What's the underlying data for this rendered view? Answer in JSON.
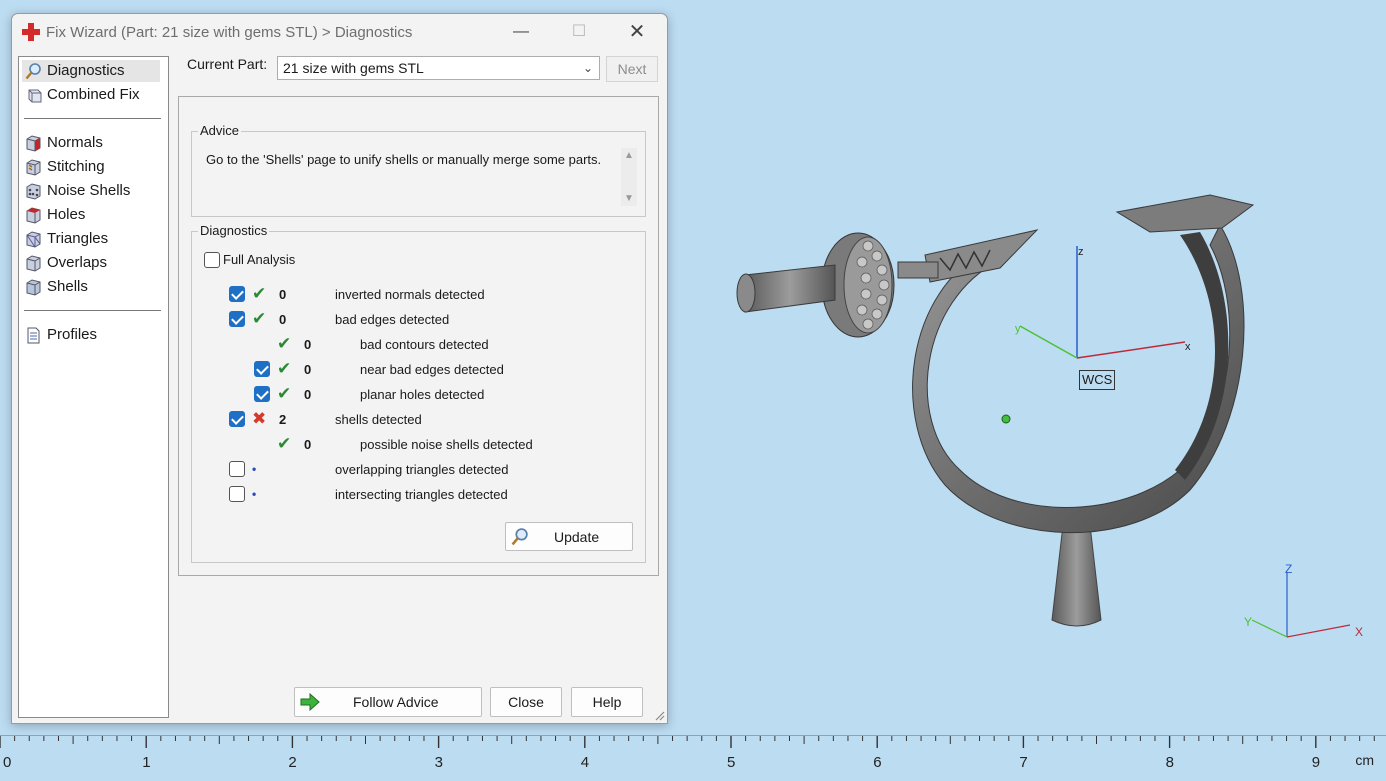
{
  "dialog": {
    "title": "Fix Wizard (Part: 21 size with gems STL) > Diagnostics",
    "window_controls": {
      "minimize": "—",
      "maximize": "☐",
      "close": "✕"
    }
  },
  "sidebar": {
    "items": [
      {
        "label": "Diagnostics",
        "icon": "magnifier-icon",
        "selected": true
      },
      {
        "label": "Combined Fix",
        "icon": "cube-icon"
      },
      {
        "label": "Normals",
        "icon": "normals-cube-icon"
      },
      {
        "label": "Stitching",
        "icon": "stitching-cube-icon"
      },
      {
        "label": "Noise Shells",
        "icon": "noise-shells-icon"
      },
      {
        "label": "Holes",
        "icon": "holes-cube-icon"
      },
      {
        "label": "Triangles",
        "icon": "triangles-cube-icon"
      },
      {
        "label": "Overlaps",
        "icon": "overlaps-cube-icon"
      },
      {
        "label": "Shells",
        "icon": "shells-cube-icon"
      },
      {
        "label": "Profiles",
        "icon": "document-icon"
      }
    ]
  },
  "current_part": {
    "label": "Current Part:",
    "value": "21 size with gems STL",
    "next_label": "Next"
  },
  "advice": {
    "title": "Advice",
    "text": "Go to the 'Shells' page to unify shells or manually merge some parts."
  },
  "diagnostics": {
    "title": "Diagnostics",
    "full_analysis_label": "Full Analysis",
    "full_analysis_checked": false,
    "rows": [
      {
        "checkbox": "checked",
        "status": "ok",
        "count": "0",
        "label": "inverted normals detected"
      },
      {
        "checkbox": "checked",
        "status": "ok",
        "count": "0",
        "label": "bad edges detected"
      },
      {
        "checkbox": "none",
        "status": "ok",
        "count": "0",
        "label": "bad contours detected"
      },
      {
        "checkbox": "checked",
        "status": "ok",
        "count": "0",
        "label": "near bad edges detected"
      },
      {
        "checkbox": "checked",
        "status": "ok",
        "count": "0",
        "label": "planar holes detected"
      },
      {
        "checkbox": "checked",
        "status": "error",
        "count": "2",
        "label": "shells detected"
      },
      {
        "checkbox": "none",
        "status": "ok",
        "count": "0",
        "label": "possible noise shells detected"
      },
      {
        "checkbox": "unchecked",
        "status": "pending",
        "count": "",
        "label": "overlapping triangles detected"
      },
      {
        "checkbox": "unchecked",
        "status": "pending",
        "count": "",
        "label": "intersecting triangles detected"
      }
    ],
    "update_label": "Update"
  },
  "buttons": {
    "follow_advice": "Follow Advice",
    "close": "Close",
    "help": "Help"
  },
  "viewport": {
    "wcs_label": "WCS",
    "wcs_axes": {
      "x": "x",
      "y": "y",
      "z": "z"
    },
    "corner_axes": {
      "x": "X",
      "y": "Y",
      "z": "Z"
    }
  },
  "ruler": {
    "ticks": [
      "0",
      "1",
      "2",
      "3",
      "4",
      "5",
      "6",
      "7",
      "8",
      "9"
    ],
    "unit": "cm"
  },
  "colors": {
    "viewport_bg": "#bcdcf2",
    "check_blue": "#1e6fc6",
    "ok_green": "#2c8a34",
    "error_red": "#d43a2a"
  }
}
